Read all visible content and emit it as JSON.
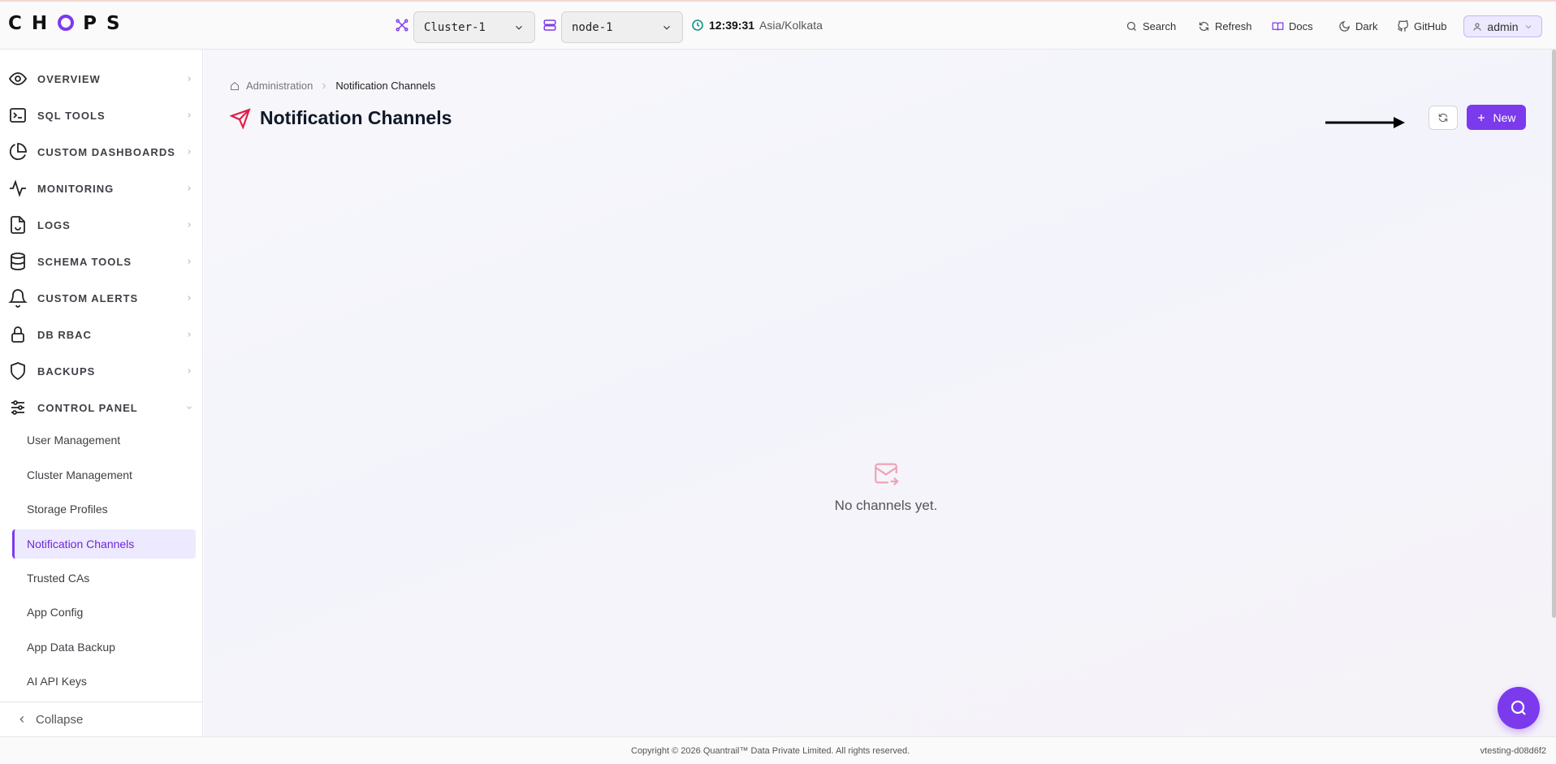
{
  "app": {
    "logo": "CHOPS"
  },
  "header": {
    "cluster_select": "Cluster-1",
    "node_select": "node-1",
    "time": "12:39:31",
    "timezone": "Asia/Kolkata",
    "nav": [
      {
        "label": "Search",
        "icon": "search-icon"
      },
      {
        "label": "Refresh",
        "icon": "refresh-icon"
      },
      {
        "label": "Docs",
        "icon": "book-icon"
      },
      {
        "label": "Dark",
        "icon": "moon-icon"
      },
      {
        "label": "GitHub",
        "icon": "github-icon"
      }
    ],
    "user": "admin"
  },
  "sidebar": {
    "items": [
      {
        "label": "OVERVIEW",
        "icon": "eye-icon"
      },
      {
        "label": "SQL TOOLS",
        "icon": "terminal-icon"
      },
      {
        "label": "CUSTOM DASHBOARDS",
        "icon": "pie-chart-icon"
      },
      {
        "label": "MONITORING",
        "icon": "activity-icon"
      },
      {
        "label": "LOGS",
        "icon": "file-icon"
      },
      {
        "label": "SCHEMA TOOLS",
        "icon": "database-icon"
      },
      {
        "label": "CUSTOM ALERTS",
        "icon": "bell-icon"
      },
      {
        "label": "DB RBAC",
        "icon": "lock-icon"
      },
      {
        "label": "BACKUPS",
        "icon": "shield-icon"
      },
      {
        "label": "CONTROL PANEL",
        "icon": "sliders-icon"
      }
    ],
    "sub_items": [
      "User Management",
      "Cluster Management",
      "Storage Profiles",
      "Notification Channels",
      "Trusted CAs",
      "App Config",
      "App Data Backup",
      "AI API Keys"
    ],
    "active_sub": "Notification Channels",
    "collapse": "Collapse"
  },
  "main": {
    "breadcrumb": {
      "parent": "Administration",
      "current": "Notification Channels"
    },
    "title": "Notification Channels",
    "new_button": "New",
    "empty_text": "No channels yet."
  },
  "footer": {
    "copyright": "Copyright © 2026 Quantrail™ Data Private Limited. All rights reserved.",
    "version": "vtesting-d08d6f2"
  },
  "colors": {
    "accent": "#7c3aed",
    "title_icon": "#e11d48",
    "empty_icon": "#f0a0b4"
  }
}
